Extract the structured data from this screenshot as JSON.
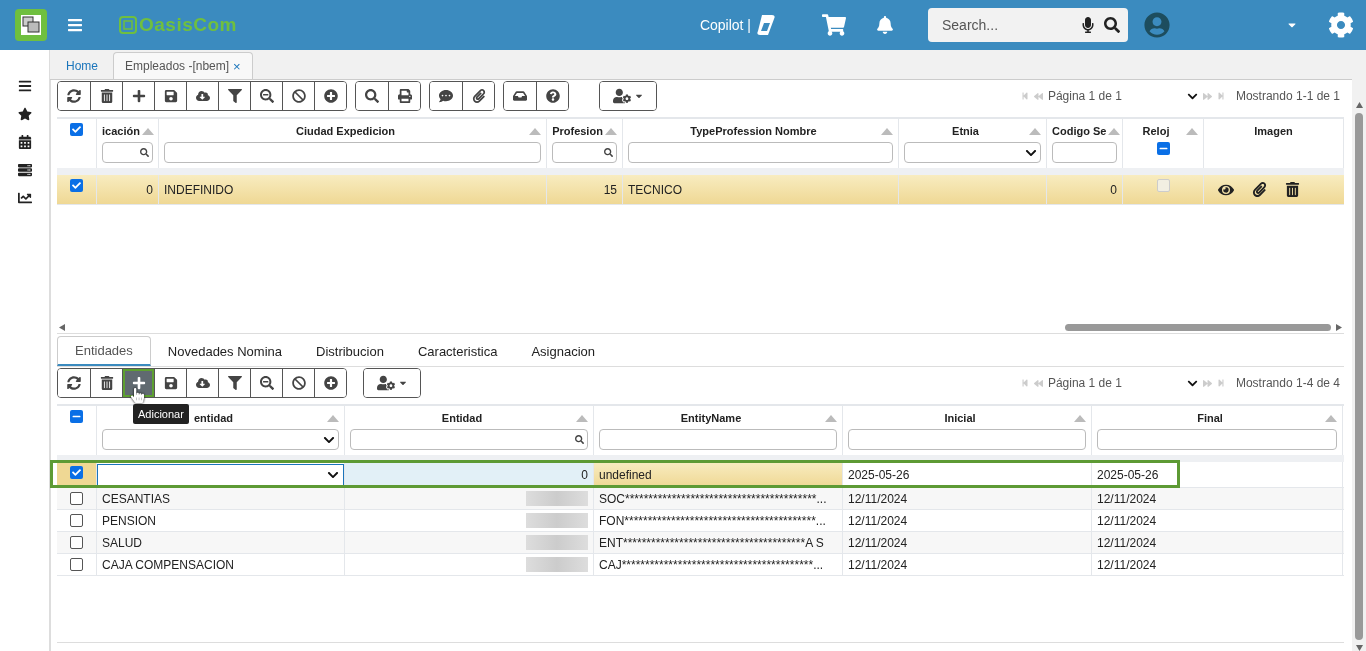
{
  "header": {
    "logo": "OasisCom",
    "copilot": "Copilot |",
    "search": {
      "placeholder": "Search..."
    }
  },
  "tabs": [
    {
      "label": "Home",
      "selected": false,
      "closable": false
    },
    {
      "label": "Empleados -[nbem]",
      "selected": true,
      "closable": true,
      "close": "×"
    }
  ],
  "main_grid": {
    "toolbar": [
      [
        {
          "kind": "refresh",
          "hovered": false
        },
        {
          "kind": "delete",
          "hovered": false
        },
        {
          "kind": "add",
          "hovered": false
        },
        {
          "kind": "save",
          "hovered": false
        },
        {
          "kind": "download",
          "hovered": false
        },
        {
          "kind": "filter",
          "hovered": false
        },
        {
          "kind": "zoom-out",
          "hovered": false
        },
        {
          "kind": "cancel",
          "hovered": false
        },
        {
          "kind": "add-circle",
          "hovered": false
        }
      ],
      [
        {
          "kind": "search",
          "hovered": false
        },
        {
          "kind": "print",
          "hovered": false
        }
      ],
      [
        {
          "kind": "comment",
          "hovered": false
        },
        {
          "kind": "attach",
          "hovered": false
        }
      ],
      [
        {
          "kind": "approve",
          "hovered": false
        },
        {
          "kind": "help",
          "hovered": false
        }
      ],
      [
        {
          "kind": "user-settings",
          "hovered": false
        }
      ]
    ],
    "pager": {
      "page": "Página 1 de 1",
      "showing": "Mostrando 1-1 de 1"
    },
    "select_all": {
      "checked": true
    },
    "columns": [
      {
        "label": "icación",
        "kind": "search"
      },
      {
        "label": "Ciudad Expedicion",
        "kind": "text"
      },
      {
        "label": "Profesion",
        "kind": "search"
      },
      {
        "label": "TypeProfession Nombre",
        "kind": "text"
      },
      {
        "label": "Etnia",
        "kind": "select"
      },
      {
        "label": "Codigo Se",
        "kind": "text"
      },
      {
        "label": "Reloj",
        "kind": "checkbox",
        "filter_partial": true
      },
      {
        "label": "Imagen",
        "kind": "none"
      }
    ],
    "rows": [
      {
        "checked": true,
        "selected": true,
        "ubicacion": "0",
        "ciudad": "INDEFINIDO",
        "profesion": "15",
        "type_profession": "TECNICO",
        "codigo": "0",
        "reloj_checked": false
      }
    ]
  },
  "detail_tabs": [
    {
      "label": "Entidades",
      "selected": true
    },
    {
      "label": "Novedades Nomina",
      "selected": false
    },
    {
      "label": "Distribucion",
      "selected": false
    },
    {
      "label": "Caracteristica",
      "selected": false
    },
    {
      "label": "Asignacion",
      "selected": false
    }
  ],
  "detail_grid": {
    "toolbar": [
      [
        {
          "kind": "refresh",
          "hovered": false
        },
        {
          "kind": "delete",
          "hovered": false
        },
        {
          "kind": "add",
          "hovered": true
        },
        {
          "kind": "save",
          "hovered": false
        },
        {
          "kind": "download",
          "hovered": false
        },
        {
          "kind": "filter",
          "hovered": false
        },
        {
          "kind": "zoom-out",
          "hovered": false
        },
        {
          "kind": "cancel",
          "hovered": false
        },
        {
          "kind": "add-circle",
          "hovered": false
        }
      ],
      [
        {
          "kind": "user-settings",
          "hovered": false
        }
      ]
    ],
    "tooltip": "Adicionar",
    "pager": {
      "page": "Página 1 de 1",
      "showing": "Mostrando 1-4 de 4"
    },
    "select_all": {
      "partial": true
    },
    "columns": [
      {
        "label": "entidad",
        "kind": "select"
      },
      {
        "label": "Entidad",
        "kind": "search"
      },
      {
        "label": "EntityName",
        "kind": "text"
      },
      {
        "label": "Inicial",
        "kind": "text"
      },
      {
        "label": "Final",
        "kind": "text"
      }
    ],
    "rows": [
      {
        "kind": "new",
        "checked": true,
        "entidad": "0",
        "entity_name": "undefined",
        "inicial": "2025-05-26",
        "final": "2025-05-26"
      },
      {
        "kind": "saved",
        "checked": false,
        "tipo": "CESANTIAS",
        "entity_name": "SOC*****************************************...",
        "inicial": "12/11/2024",
        "final": "12/11/2024"
      },
      {
        "kind": "saved",
        "checked": false,
        "tipo": "PENSION",
        "entity_name": "FON*****************************************...",
        "inicial": "12/11/2024",
        "final": "12/11/2024"
      },
      {
        "kind": "saved",
        "checked": false,
        "tipo": "SALUD",
        "entity_name": "ENT***************************************A S",
        "inicial": "12/11/2024",
        "final": "12/11/2024"
      },
      {
        "kind": "saved",
        "checked": false,
        "tipo": "CAJA COMPENSACION",
        "entity_name": "CAJ*****************************************...",
        "inicial": "12/11/2024",
        "final": "12/11/2024"
      }
    ]
  }
}
